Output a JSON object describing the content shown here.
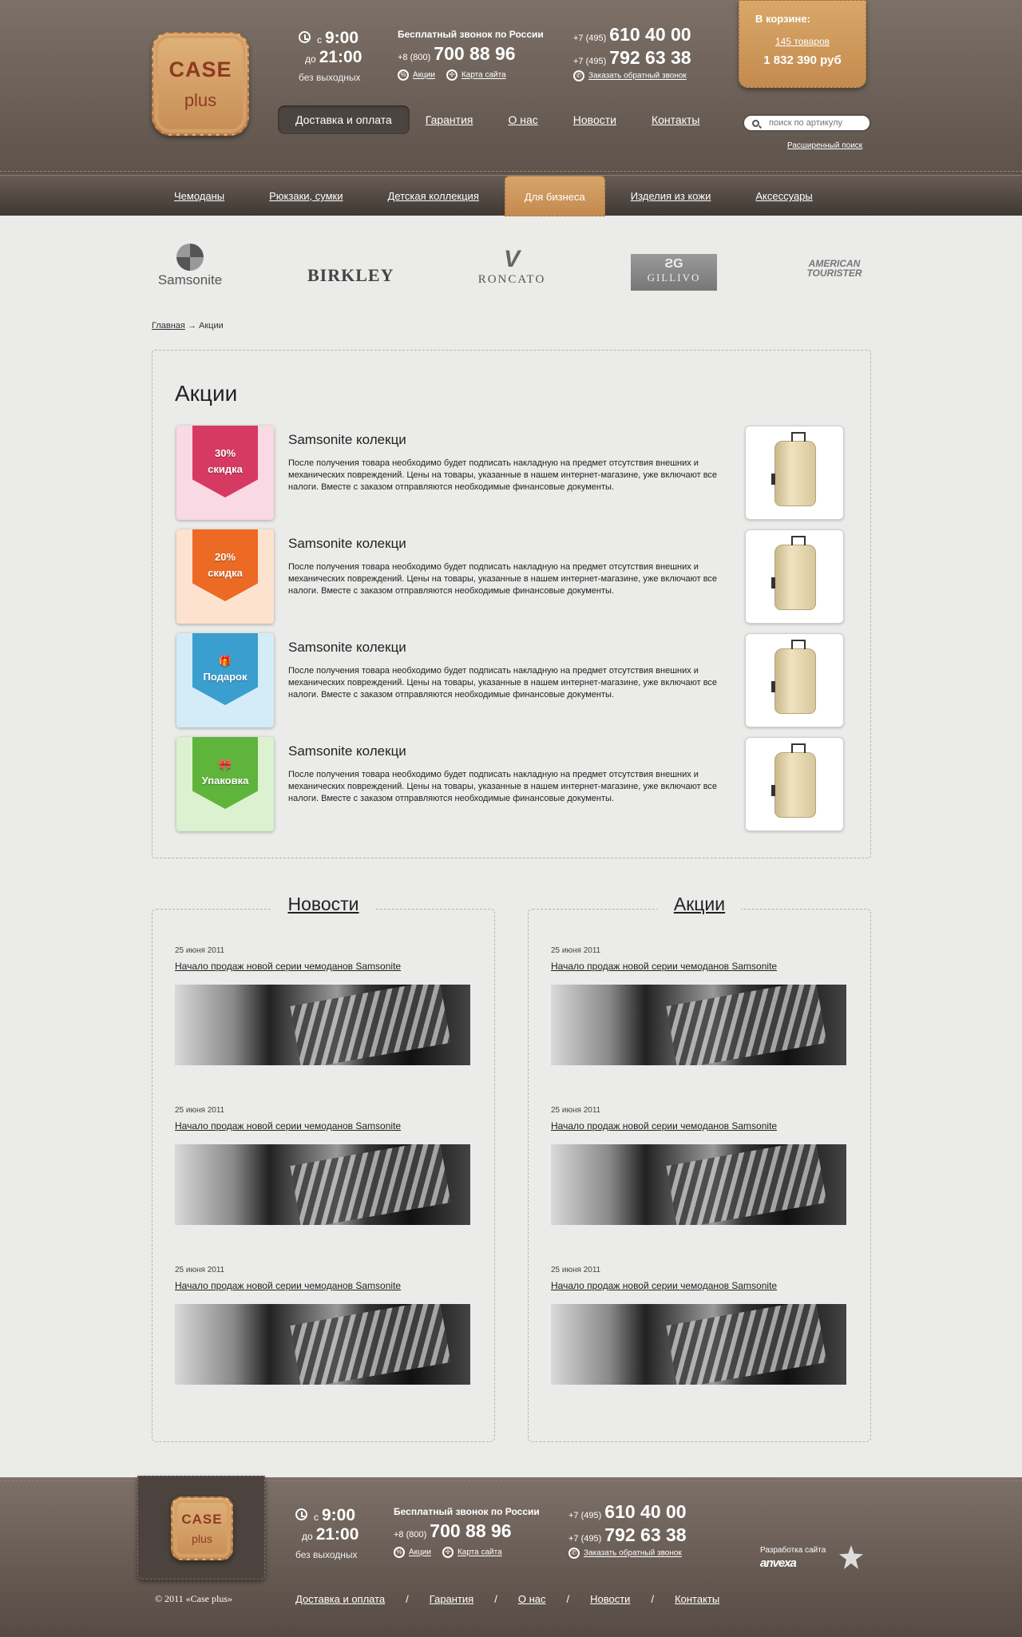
{
  "header": {
    "logo": {
      "line1": "CASE",
      "line2": "plus"
    },
    "hours": {
      "from_prefix": "с",
      "from": "9:00",
      "to_prefix": "до",
      "to": "21:00",
      "note": "без выходных"
    },
    "free_call": {
      "label": "Бесплатный звонок по России",
      "code": "+8 (800)",
      "number": "700 88 96"
    },
    "phones": [
      {
        "code": "+7 (495)",
        "number": "610 40 00"
      },
      {
        "code": "+7 (495)",
        "number": "792 63 38"
      }
    ],
    "links": {
      "promos": "Акции",
      "sitemap": "Карта сайта",
      "callback": "Заказать обратный звонок"
    },
    "cart": {
      "title": "В корзине:",
      "count": "145 товаров",
      "sum": "1 832 390 руб"
    },
    "nav": [
      "Доставка и оплата",
      "Гарантия",
      "О нас",
      "Новости",
      "Контакты"
    ],
    "search": {
      "placeholder": "поиск по артикулу",
      "advanced": "Расширенный поиск"
    }
  },
  "categories": [
    "Чемоданы",
    "Рюкзаки, сумки",
    "Детская коллекция",
    "Для бизнеса",
    "Изделия из кожи",
    "Аксессуары"
  ],
  "brands": [
    "Samsonite",
    "BIRKLEY",
    "RONCATO",
    "GILLIVO",
    "AMERICAN TOURISTER"
  ],
  "breadcrumb": {
    "home": "Главная",
    "arrow": "→",
    "current": "Акции"
  },
  "promotions": {
    "title": "Акции",
    "items": [
      {
        "badge1": "30%",
        "badge2": "скидка",
        "color": "#d63a63",
        "bg": "#f9d9e4",
        "title": "Samsonite колекци",
        "text": "После получения товара необходимо будет подписать накладную на предмет отсутствия внешних и механических повреждений. Цены на товары, указанные в нашем интернет-магазине, уже включают все налоги. Вместе с заказом отправляются необходимые финансовые документы."
      },
      {
        "badge1": "20%",
        "badge2": "скидка",
        "color": "#ec6a24",
        "bg": "#fde3cf",
        "title": "Samsonite колекци",
        "text": "После получения товара необходимо будет подписать накладную на предмет отсутствия внешних и механических повреждений. Цены на товары, указанные в нашем интернет-магазине, уже включают все налоги. Вместе с заказом отправляются необходимые финансовые документы."
      },
      {
        "badge1": "🎁",
        "badge2": "Подарок",
        "color": "#3a9ecf",
        "bg": "#d3ecf8",
        "title": "Samsonite колекци",
        "text": "После получения товара необходимо будет подписать накладную на предмет отсутствия внешних и механических повреждений. Цены на товары, указанные в нашем интернет-магазине, уже включают все налоги. Вместе с заказом отправляются необходимые финансовые документы."
      },
      {
        "badge1": "🎀",
        "badge2": "Упаковка",
        "color": "#5fb43c",
        "bg": "#dcf1cf",
        "title": "Samsonite колекци",
        "text": "После получения товара необходимо будет подписать накладную на предмет отсутствия внешних и механических повреждений. Цены на товары, указанные в нашем интернет-магазине, уже включают все налоги. Вместе с заказом отправляются необходимые финансовые документы."
      }
    ]
  },
  "news": {
    "title": "Новости",
    "items": [
      {
        "date": "25 июня 2011",
        "title": "Начало продаж новой серии чемоданов Samsonite"
      },
      {
        "date": "25 июня 2011",
        "title": "Начало продаж новой серии чемоданов Samsonite"
      },
      {
        "date": "25 июня 2011",
        "title": "Начало продаж новой серии чемоданов Samsonite"
      }
    ]
  },
  "actions": {
    "title": "Акции",
    "items": [
      {
        "date": "25 июня 2011",
        "title": "Начало продаж новой серии чемоданов Samsonite"
      },
      {
        "date": "25 июня 2011",
        "title": "Начало продаж новой серии чемоданов Samsonite"
      },
      {
        "date": "25 июня 2011",
        "title": "Начало продаж новой серии чемоданов Samsonite"
      }
    ]
  },
  "footer": {
    "copyright": "© 2011 «Case plus»",
    "nav": [
      "Доставка и оплата",
      "Гарантия",
      "О нас",
      "Новости",
      "Контакты"
    ],
    "separator": "/",
    "developer_label": "Разработка сайта",
    "developer": "anvexa"
  }
}
